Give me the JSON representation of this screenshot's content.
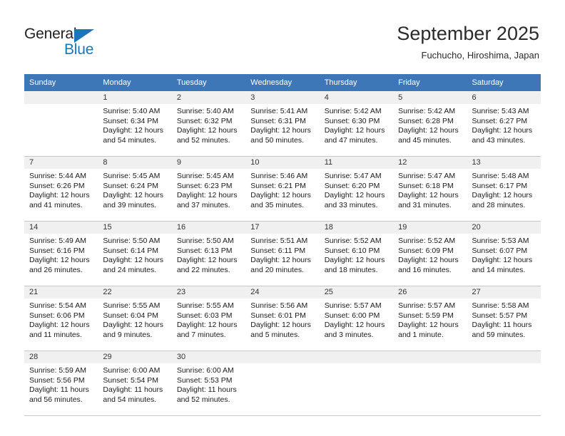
{
  "brand": {
    "name_top": "General",
    "name_bottom": "Blue",
    "accent_color": "#1b75bb"
  },
  "header": {
    "title": "September 2025",
    "subtitle": "Fuchucho, Hiroshima, Japan",
    "header_bg_color": "#3d77b8",
    "daynum_bg_color": "#f0f0f0"
  },
  "weekday_headers": [
    "Sunday",
    "Monday",
    "Tuesday",
    "Wednesday",
    "Thursday",
    "Friday",
    "Saturday"
  ],
  "weeks": [
    [
      {
        "day": "",
        "sunrise": "",
        "sunset": "",
        "daylight_line1": "",
        "daylight_line2": "",
        "empty": true
      },
      {
        "day": "1",
        "sunrise": "Sunrise: 5:40 AM",
        "sunset": "Sunset: 6:34 PM",
        "daylight_line1": "Daylight: 12 hours",
        "daylight_line2": "and 54 minutes."
      },
      {
        "day": "2",
        "sunrise": "Sunrise: 5:40 AM",
        "sunset": "Sunset: 6:32 PM",
        "daylight_line1": "Daylight: 12 hours",
        "daylight_line2": "and 52 minutes."
      },
      {
        "day": "3",
        "sunrise": "Sunrise: 5:41 AM",
        "sunset": "Sunset: 6:31 PM",
        "daylight_line1": "Daylight: 12 hours",
        "daylight_line2": "and 50 minutes."
      },
      {
        "day": "4",
        "sunrise": "Sunrise: 5:42 AM",
        "sunset": "Sunset: 6:30 PM",
        "daylight_line1": "Daylight: 12 hours",
        "daylight_line2": "and 47 minutes."
      },
      {
        "day": "5",
        "sunrise": "Sunrise: 5:42 AM",
        "sunset": "Sunset: 6:28 PM",
        "daylight_line1": "Daylight: 12 hours",
        "daylight_line2": "and 45 minutes."
      },
      {
        "day": "6",
        "sunrise": "Sunrise: 5:43 AM",
        "sunset": "Sunset: 6:27 PM",
        "daylight_line1": "Daylight: 12 hours",
        "daylight_line2": "and 43 minutes."
      }
    ],
    [
      {
        "day": "7",
        "sunrise": "Sunrise: 5:44 AM",
        "sunset": "Sunset: 6:26 PM",
        "daylight_line1": "Daylight: 12 hours",
        "daylight_line2": "and 41 minutes."
      },
      {
        "day": "8",
        "sunrise": "Sunrise: 5:45 AM",
        "sunset": "Sunset: 6:24 PM",
        "daylight_line1": "Daylight: 12 hours",
        "daylight_line2": "and 39 minutes."
      },
      {
        "day": "9",
        "sunrise": "Sunrise: 5:45 AM",
        "sunset": "Sunset: 6:23 PM",
        "daylight_line1": "Daylight: 12 hours",
        "daylight_line2": "and 37 minutes."
      },
      {
        "day": "10",
        "sunrise": "Sunrise: 5:46 AM",
        "sunset": "Sunset: 6:21 PM",
        "daylight_line1": "Daylight: 12 hours",
        "daylight_line2": "and 35 minutes."
      },
      {
        "day": "11",
        "sunrise": "Sunrise: 5:47 AM",
        "sunset": "Sunset: 6:20 PM",
        "daylight_line1": "Daylight: 12 hours",
        "daylight_line2": "and 33 minutes."
      },
      {
        "day": "12",
        "sunrise": "Sunrise: 5:47 AM",
        "sunset": "Sunset: 6:18 PM",
        "daylight_line1": "Daylight: 12 hours",
        "daylight_line2": "and 31 minutes."
      },
      {
        "day": "13",
        "sunrise": "Sunrise: 5:48 AM",
        "sunset": "Sunset: 6:17 PM",
        "daylight_line1": "Daylight: 12 hours",
        "daylight_line2": "and 28 minutes."
      }
    ],
    [
      {
        "day": "14",
        "sunrise": "Sunrise: 5:49 AM",
        "sunset": "Sunset: 6:16 PM",
        "daylight_line1": "Daylight: 12 hours",
        "daylight_line2": "and 26 minutes."
      },
      {
        "day": "15",
        "sunrise": "Sunrise: 5:50 AM",
        "sunset": "Sunset: 6:14 PM",
        "daylight_line1": "Daylight: 12 hours",
        "daylight_line2": "and 24 minutes."
      },
      {
        "day": "16",
        "sunrise": "Sunrise: 5:50 AM",
        "sunset": "Sunset: 6:13 PM",
        "daylight_line1": "Daylight: 12 hours",
        "daylight_line2": "and 22 minutes."
      },
      {
        "day": "17",
        "sunrise": "Sunrise: 5:51 AM",
        "sunset": "Sunset: 6:11 PM",
        "daylight_line1": "Daylight: 12 hours",
        "daylight_line2": "and 20 minutes."
      },
      {
        "day": "18",
        "sunrise": "Sunrise: 5:52 AM",
        "sunset": "Sunset: 6:10 PM",
        "daylight_line1": "Daylight: 12 hours",
        "daylight_line2": "and 18 minutes."
      },
      {
        "day": "19",
        "sunrise": "Sunrise: 5:52 AM",
        "sunset": "Sunset: 6:09 PM",
        "daylight_line1": "Daylight: 12 hours",
        "daylight_line2": "and 16 minutes."
      },
      {
        "day": "20",
        "sunrise": "Sunrise: 5:53 AM",
        "sunset": "Sunset: 6:07 PM",
        "daylight_line1": "Daylight: 12 hours",
        "daylight_line2": "and 14 minutes."
      }
    ],
    [
      {
        "day": "21",
        "sunrise": "Sunrise: 5:54 AM",
        "sunset": "Sunset: 6:06 PM",
        "daylight_line1": "Daylight: 12 hours",
        "daylight_line2": "and 11 minutes."
      },
      {
        "day": "22",
        "sunrise": "Sunrise: 5:55 AM",
        "sunset": "Sunset: 6:04 PM",
        "daylight_line1": "Daylight: 12 hours",
        "daylight_line2": "and 9 minutes."
      },
      {
        "day": "23",
        "sunrise": "Sunrise: 5:55 AM",
        "sunset": "Sunset: 6:03 PM",
        "daylight_line1": "Daylight: 12 hours",
        "daylight_line2": "and 7 minutes."
      },
      {
        "day": "24",
        "sunrise": "Sunrise: 5:56 AM",
        "sunset": "Sunset: 6:01 PM",
        "daylight_line1": "Daylight: 12 hours",
        "daylight_line2": "and 5 minutes."
      },
      {
        "day": "25",
        "sunrise": "Sunrise: 5:57 AM",
        "sunset": "Sunset: 6:00 PM",
        "daylight_line1": "Daylight: 12 hours",
        "daylight_line2": "and 3 minutes."
      },
      {
        "day": "26",
        "sunrise": "Sunrise: 5:57 AM",
        "sunset": "Sunset: 5:59 PM",
        "daylight_line1": "Daylight: 12 hours",
        "daylight_line2": "and 1 minute."
      },
      {
        "day": "27",
        "sunrise": "Sunrise: 5:58 AM",
        "sunset": "Sunset: 5:57 PM",
        "daylight_line1": "Daylight: 11 hours",
        "daylight_line2": "and 59 minutes."
      }
    ],
    [
      {
        "day": "28",
        "sunrise": "Sunrise: 5:59 AM",
        "sunset": "Sunset: 5:56 PM",
        "daylight_line1": "Daylight: 11 hours",
        "daylight_line2": "and 56 minutes."
      },
      {
        "day": "29",
        "sunrise": "Sunrise: 6:00 AM",
        "sunset": "Sunset: 5:54 PM",
        "daylight_line1": "Daylight: 11 hours",
        "daylight_line2": "and 54 minutes."
      },
      {
        "day": "30",
        "sunrise": "Sunrise: 6:00 AM",
        "sunset": "Sunset: 5:53 PM",
        "daylight_line1": "Daylight: 11 hours",
        "daylight_line2": "and 52 minutes."
      },
      {
        "day": "",
        "sunrise": "",
        "sunset": "",
        "daylight_line1": "",
        "daylight_line2": "",
        "empty": true
      },
      {
        "day": "",
        "sunrise": "",
        "sunset": "",
        "daylight_line1": "",
        "daylight_line2": "",
        "empty": true
      },
      {
        "day": "",
        "sunrise": "",
        "sunset": "",
        "daylight_line1": "",
        "daylight_line2": "",
        "empty": true
      },
      {
        "day": "",
        "sunrise": "",
        "sunset": "",
        "daylight_line1": "",
        "daylight_line2": "",
        "empty": true
      }
    ]
  ]
}
